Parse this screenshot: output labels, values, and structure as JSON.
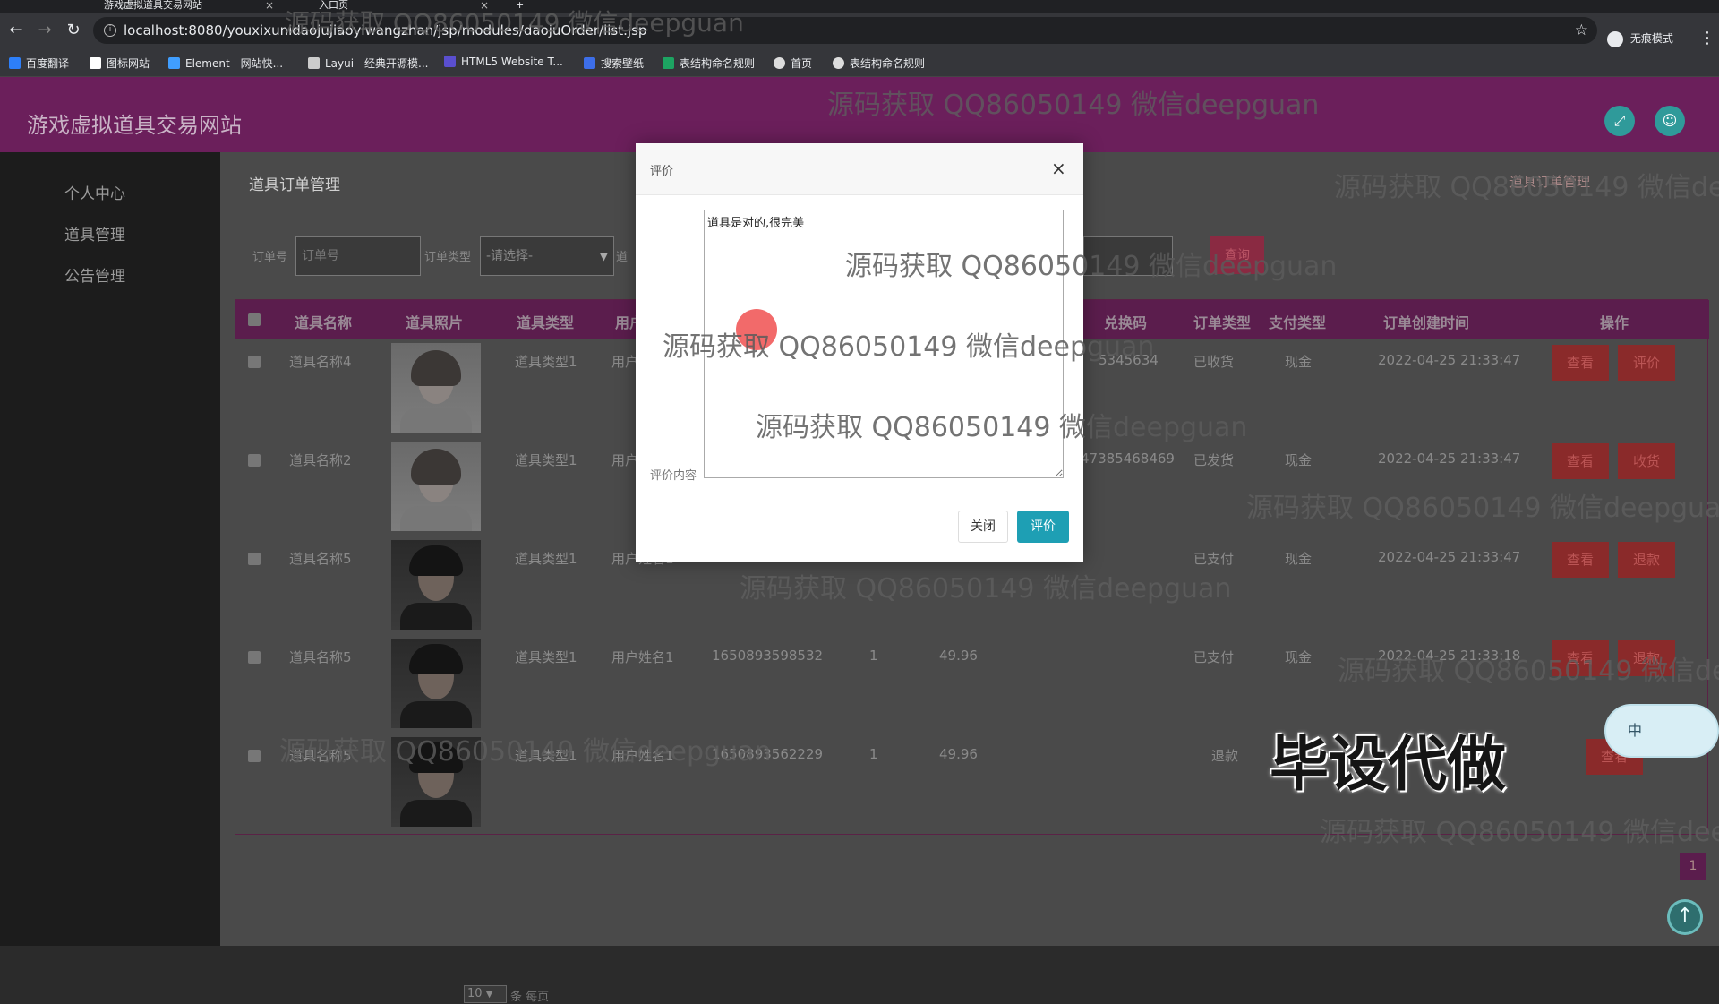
{
  "browser": {
    "tabs": [
      {
        "title": "游戏虚拟道具交易网站"
      },
      {
        "title": "入口页"
      }
    ],
    "new_tab": "+",
    "url": "localhost:8080/youxixunidaojujiaoyiwangzhan/jsp/modules/daojuOrder/list.jsp",
    "mode_label": "无痕模式",
    "bookmarks": [
      {
        "label": "百度翻译",
        "color": "#2d7ff9"
      },
      {
        "label": "图标网站",
        "color": "#ffffff"
      },
      {
        "label": "Element - 网站快...",
        "color": "#409eff"
      },
      {
        "label": "Layui - 经典开源模...",
        "color": "#cccccc"
      },
      {
        "label": "HTML5 Website T...",
        "color": "#5a4fcf"
      },
      {
        "label": "搜索壁纸",
        "color": "#3d6ee8"
      },
      {
        "label": "表结构命名规则",
        "color": "#1da462"
      },
      {
        "label": "首页",
        "color": "#dddddd"
      },
      {
        "label": "表结构命名规则",
        "color": "#dddddd"
      }
    ]
  },
  "header": {
    "site_title": "游戏虚拟道具交易网站"
  },
  "sidebar": {
    "items": [
      {
        "label": "个人中心"
      },
      {
        "label": "道具管理"
      },
      {
        "label": "公告管理"
      }
    ]
  },
  "page": {
    "title": "道具订单管理",
    "breadcrumb": "道具订单管理"
  },
  "filters": {
    "order_no_label": "订单号",
    "order_no_placeholder": "订单号",
    "order_type_label": "订单类型",
    "order_type_value": "-请选择-",
    "name_label": "道",
    "search_label": "查询"
  },
  "table": {
    "headers": [
      "道具名称",
      "道具照片",
      "道具类型",
      "用户",
      "兑换码",
      "订单类型",
      "支付类型",
      "订单创建时间",
      "操作"
    ],
    "rows": [
      {
        "name": "道具名称4",
        "photo": "female",
        "type": "道具类型1",
        "user": "用户",
        "code": "5345634",
        "order_status": "已收货",
        "pay": "现金",
        "created": "2022-04-25 21:33:47",
        "actions": [
          "查看",
          "评价"
        ]
      },
      {
        "name": "道具名称2",
        "photo": "female",
        "type": "道具类型1",
        "user": "用户",
        "code": "47385468469",
        "order_status": "已发货",
        "pay": "现金",
        "created": "2022-04-25 21:33:47",
        "actions": [
          "查看",
          "收货"
        ]
      },
      {
        "name": "道具名称5",
        "photo": "male",
        "type": "道具类型1",
        "user": "用户姓名1",
        "code": "",
        "order_status": "已支付",
        "pay": "现金",
        "created": "2022-04-25 21:33:47",
        "actions": [
          "查看",
          "退款"
        ]
      },
      {
        "name": "道具名称5",
        "photo": "male",
        "type": "道具类型1",
        "user": "用户姓名1",
        "order_no": "1650893598532",
        "qty": "1",
        "price": "49.96",
        "code": "",
        "order_status": "已支付",
        "pay": "现金",
        "created": "2022-04-25 21:33:18",
        "actions": [
          "查看",
          "退款"
        ]
      },
      {
        "name": "道具名称5",
        "photo": "male",
        "type": "道具类型1",
        "user": "用户姓名1",
        "order_no": "1650893562229",
        "qty": "1",
        "price": "49.96",
        "code": "",
        "order_status": "退款",
        "pay": "",
        "created": "",
        "actions": [
          "查看"
        ]
      }
    ]
  },
  "pagination": {
    "page_size": "10",
    "page_size_label": "条 每页",
    "current_page": "1"
  },
  "modal": {
    "title": "评价",
    "field_label": "评价内容",
    "content": "道具是对的,很完美",
    "close_label": "关闭",
    "submit_label": "评价"
  },
  "overlay": {
    "watermark": "源码获取 QQ86050149 微信deepguan",
    "banner": "毕设代做",
    "ime_label": "中"
  }
}
